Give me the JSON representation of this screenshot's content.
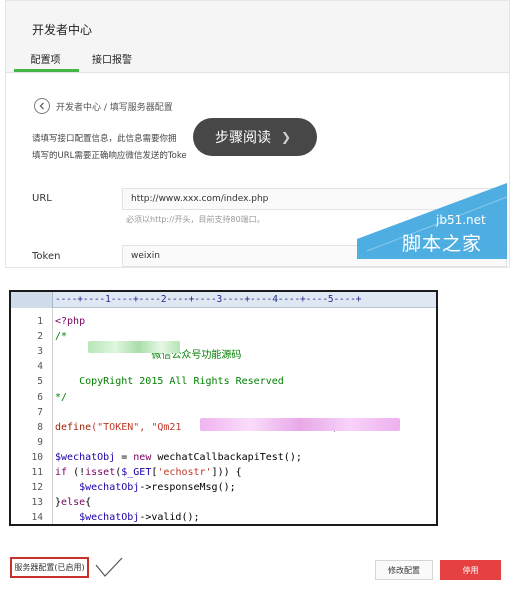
{
  "config": {
    "title": "开发者中心",
    "tabs": [
      {
        "label": "配置项",
        "active": true
      },
      {
        "label": "接口报警",
        "active": false
      }
    ],
    "breadcrumb": "开发者中心 / 填写服务器配置",
    "desc_line_1": "请填写接口配置信息，此信息需要你拥",
    "desc_line_2": "填写的URL需要正确响应微信发送的Toke",
    "url_label": "URL",
    "url_value": "http://www.xxx.com/index.php",
    "url_hint": "必须以http://开头，目前支持80端口。",
    "token_label": "Token",
    "token_value": "weixin"
  },
  "overlay": {
    "label": "步骤阅读",
    "icon": "chevron-right-icon"
  },
  "watermark": {
    "site": "jb51.net",
    "name": "脚本之家",
    "color": "#3fa7e0"
  },
  "editor": {
    "ruler": "----+----1----+----2----+----3----+----4----+----5----+",
    "lines": [
      {
        "num": "1",
        "parts": [
          {
            "text": "<?php",
            "cls": "c-kw"
          }
        ]
      },
      {
        "num": "2",
        "parts": [
          {
            "text": "/*",
            "cls": "c-cm"
          }
        ]
      },
      {
        "num": "3",
        "parts": [
          {
            "text": "                微信公众号功能源码",
            "cls": "c-cm"
          }
        ]
      },
      {
        "num": "4",
        "parts": []
      },
      {
        "num": "5",
        "parts": [
          {
            "text": "    CopyRight 2015 All Rights Reserved",
            "cls": "c-cm"
          }
        ]
      },
      {
        "num": "6",
        "parts": [
          {
            "text": "*/",
            "cls": "c-cm"
          }
        ]
      },
      {
        "num": "7",
        "parts": []
      },
      {
        "num": "8",
        "parts": [
          {
            "text": "define",
            "cls": "c-fn"
          },
          {
            "text": "(\"TOKEN\", \"Qm21",
            "cls": "c-str"
          },
          {
            "text": "                         ;",
            "cls": "c-blk"
          }
        ]
      },
      {
        "num": "9",
        "parts": []
      },
      {
        "num": "10",
        "parts": [
          {
            "text": "$wechatObj",
            "cls": "c-var"
          },
          {
            "text": " = ",
            "cls": "c-blk"
          },
          {
            "text": "new",
            "cls": "c-kw"
          },
          {
            "text": " wechatCallbackapiTest();",
            "cls": "c-blk"
          }
        ]
      },
      {
        "num": "11",
        "parts": [
          {
            "text": "if",
            "cls": "c-kw"
          },
          {
            "text": " (!",
            "cls": "c-blk"
          },
          {
            "text": "isset",
            "cls": "c-kw"
          },
          {
            "text": "(",
            "cls": "c-blk"
          },
          {
            "text": "$_GET",
            "cls": "c-var"
          },
          {
            "text": "[",
            "cls": "c-blk"
          },
          {
            "text": "'echostr'",
            "cls": "c-str"
          },
          {
            "text": "])) {",
            "cls": "c-blk"
          }
        ]
      },
      {
        "num": "12",
        "parts": [
          {
            "text": "    ",
            "cls": "c-blk"
          },
          {
            "text": "$wechatObj",
            "cls": "c-var"
          },
          {
            "text": "->responseMsg();",
            "cls": "c-blk"
          }
        ]
      },
      {
        "num": "13",
        "parts": [
          {
            "text": "}",
            "cls": "c-blk"
          },
          {
            "text": "else",
            "cls": "c-kw"
          },
          {
            "text": "{",
            "cls": "c-blk"
          }
        ]
      },
      {
        "num": "14",
        "parts": [
          {
            "text": "    ",
            "cls": "c-blk"
          },
          {
            "text": "$wechatObj",
            "cls": "c-var"
          },
          {
            "text": "->valid();",
            "cls": "c-blk"
          }
        ]
      }
    ]
  },
  "footer": {
    "status_label": "服务器配置(已启用)",
    "edit_label": "修改配置",
    "stop_label": "停用",
    "accent": "#e64141"
  }
}
